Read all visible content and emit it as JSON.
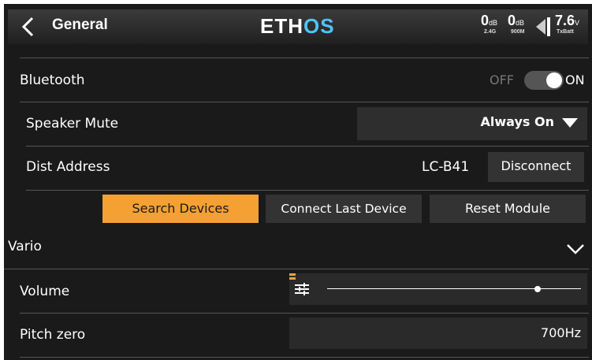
{
  "header": {
    "title": "General",
    "logo_main": "ETH",
    "logo_accent": "OS",
    "rssi_24": {
      "value": "0",
      "unit": "dB",
      "sub": "2.4G"
    },
    "rssi_900": {
      "value": "0",
      "unit": "dB",
      "sub": "900M"
    },
    "battery": {
      "value": "7.6",
      "unit": "V",
      "sub": "TxBatt"
    }
  },
  "bluetooth": {
    "label": "Bluetooth",
    "toggle_off": "OFF",
    "toggle_on": "ON",
    "state": "on"
  },
  "speaker_mute": {
    "label": "Speaker Mute",
    "value": "Always On"
  },
  "dist_address": {
    "label": "Dist Address",
    "value": "LC-B41",
    "disconnect": "Disconnect"
  },
  "actions": {
    "search": "Search Devices",
    "connect_last": "Connect Last Device",
    "reset": "Reset Module"
  },
  "vario": {
    "label": "Vario"
  },
  "volume": {
    "label": "Volume",
    "level": 0.83
  },
  "pitch_zero": {
    "label": "Pitch zero",
    "value": "700Hz"
  },
  "colors": {
    "accent": "#f5a033",
    "logo_accent": "#4fc3ff"
  }
}
